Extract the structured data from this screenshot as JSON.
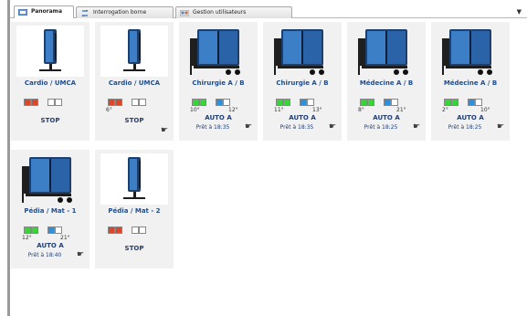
{
  "tabs": [
    {
      "label": "Panorama",
      "icon": "panorama-icon",
      "active": true
    },
    {
      "label": "Interrogation borne",
      "icon": "refresh-arrows-icon",
      "active": false
    },
    {
      "label": "Gestion utilisateurs",
      "icon": "users-icon",
      "active": false
    }
  ],
  "scroll_arrow": "▼",
  "colors": {
    "red": "#d9482b",
    "green": "#38d43a",
    "blue": "#2f8fd8",
    "empty": "#ffffff",
    "label": "#1f4d8f"
  },
  "cards": [
    {
      "name": "Cardio / UMCA",
      "image": "single-cart-icon",
      "squares": [
        "red",
        "red",
        "empty",
        "empty"
      ],
      "temps": [
        "",
        ""
      ],
      "status": "STOP",
      "ready": "",
      "hand": false
    },
    {
      "name": "Cardio / UMCA",
      "image": "single-cart-icon",
      "squares": [
        "red",
        "red",
        "empty",
        "empty"
      ],
      "temps": [
        "6°",
        ""
      ],
      "status": "STOP",
      "ready": "",
      "hand": true
    },
    {
      "name": "Chirurgie A / B",
      "image": "double-cart-icon",
      "squares": [
        "green",
        "green",
        "blue",
        "empty"
      ],
      "temps": [
        "10°",
        "12°"
      ],
      "status": "AUTO A",
      "ready": "Prêt à 18:35",
      "hand": true
    },
    {
      "name": "Chirurgie A / B",
      "image": "double-cart-icon",
      "squares": [
        "green",
        "green",
        "blue",
        "empty"
      ],
      "temps": [
        "11°",
        "13°"
      ],
      "status": "AUTO A",
      "ready": "Prêt à 18:35",
      "hand": true
    },
    {
      "name": "Médecine A / B",
      "image": "double-cart-icon",
      "squares": [
        "green",
        "green",
        "blue",
        "empty"
      ],
      "temps": [
        "8°",
        "21°"
      ],
      "status": "AUTO A",
      "ready": "Prêt à 18:25",
      "hand": true
    },
    {
      "name": "Médecine A / B",
      "image": "double-cart-icon",
      "squares": [
        "green",
        "green",
        "blue",
        "empty"
      ],
      "temps": [
        "2°",
        "10°"
      ],
      "status": "AUTO A",
      "ready": "Prêt à 18:25",
      "hand": true
    },
    {
      "name": "Pédia / Mat - 1",
      "image": "double-cart-icon",
      "squares": [
        "green",
        "green",
        "blue",
        "empty"
      ],
      "temps": [
        "12°",
        "21°"
      ],
      "status": "AUTO A",
      "ready": "Prêt à 18:40",
      "hand": true
    },
    {
      "name": "Pédia / Mat - 2",
      "image": "single-cart-icon",
      "squares": [
        "red",
        "red",
        "empty",
        "empty"
      ],
      "temps": [
        "",
        ""
      ],
      "status": "STOP",
      "ready": "",
      "hand": false
    }
  ]
}
